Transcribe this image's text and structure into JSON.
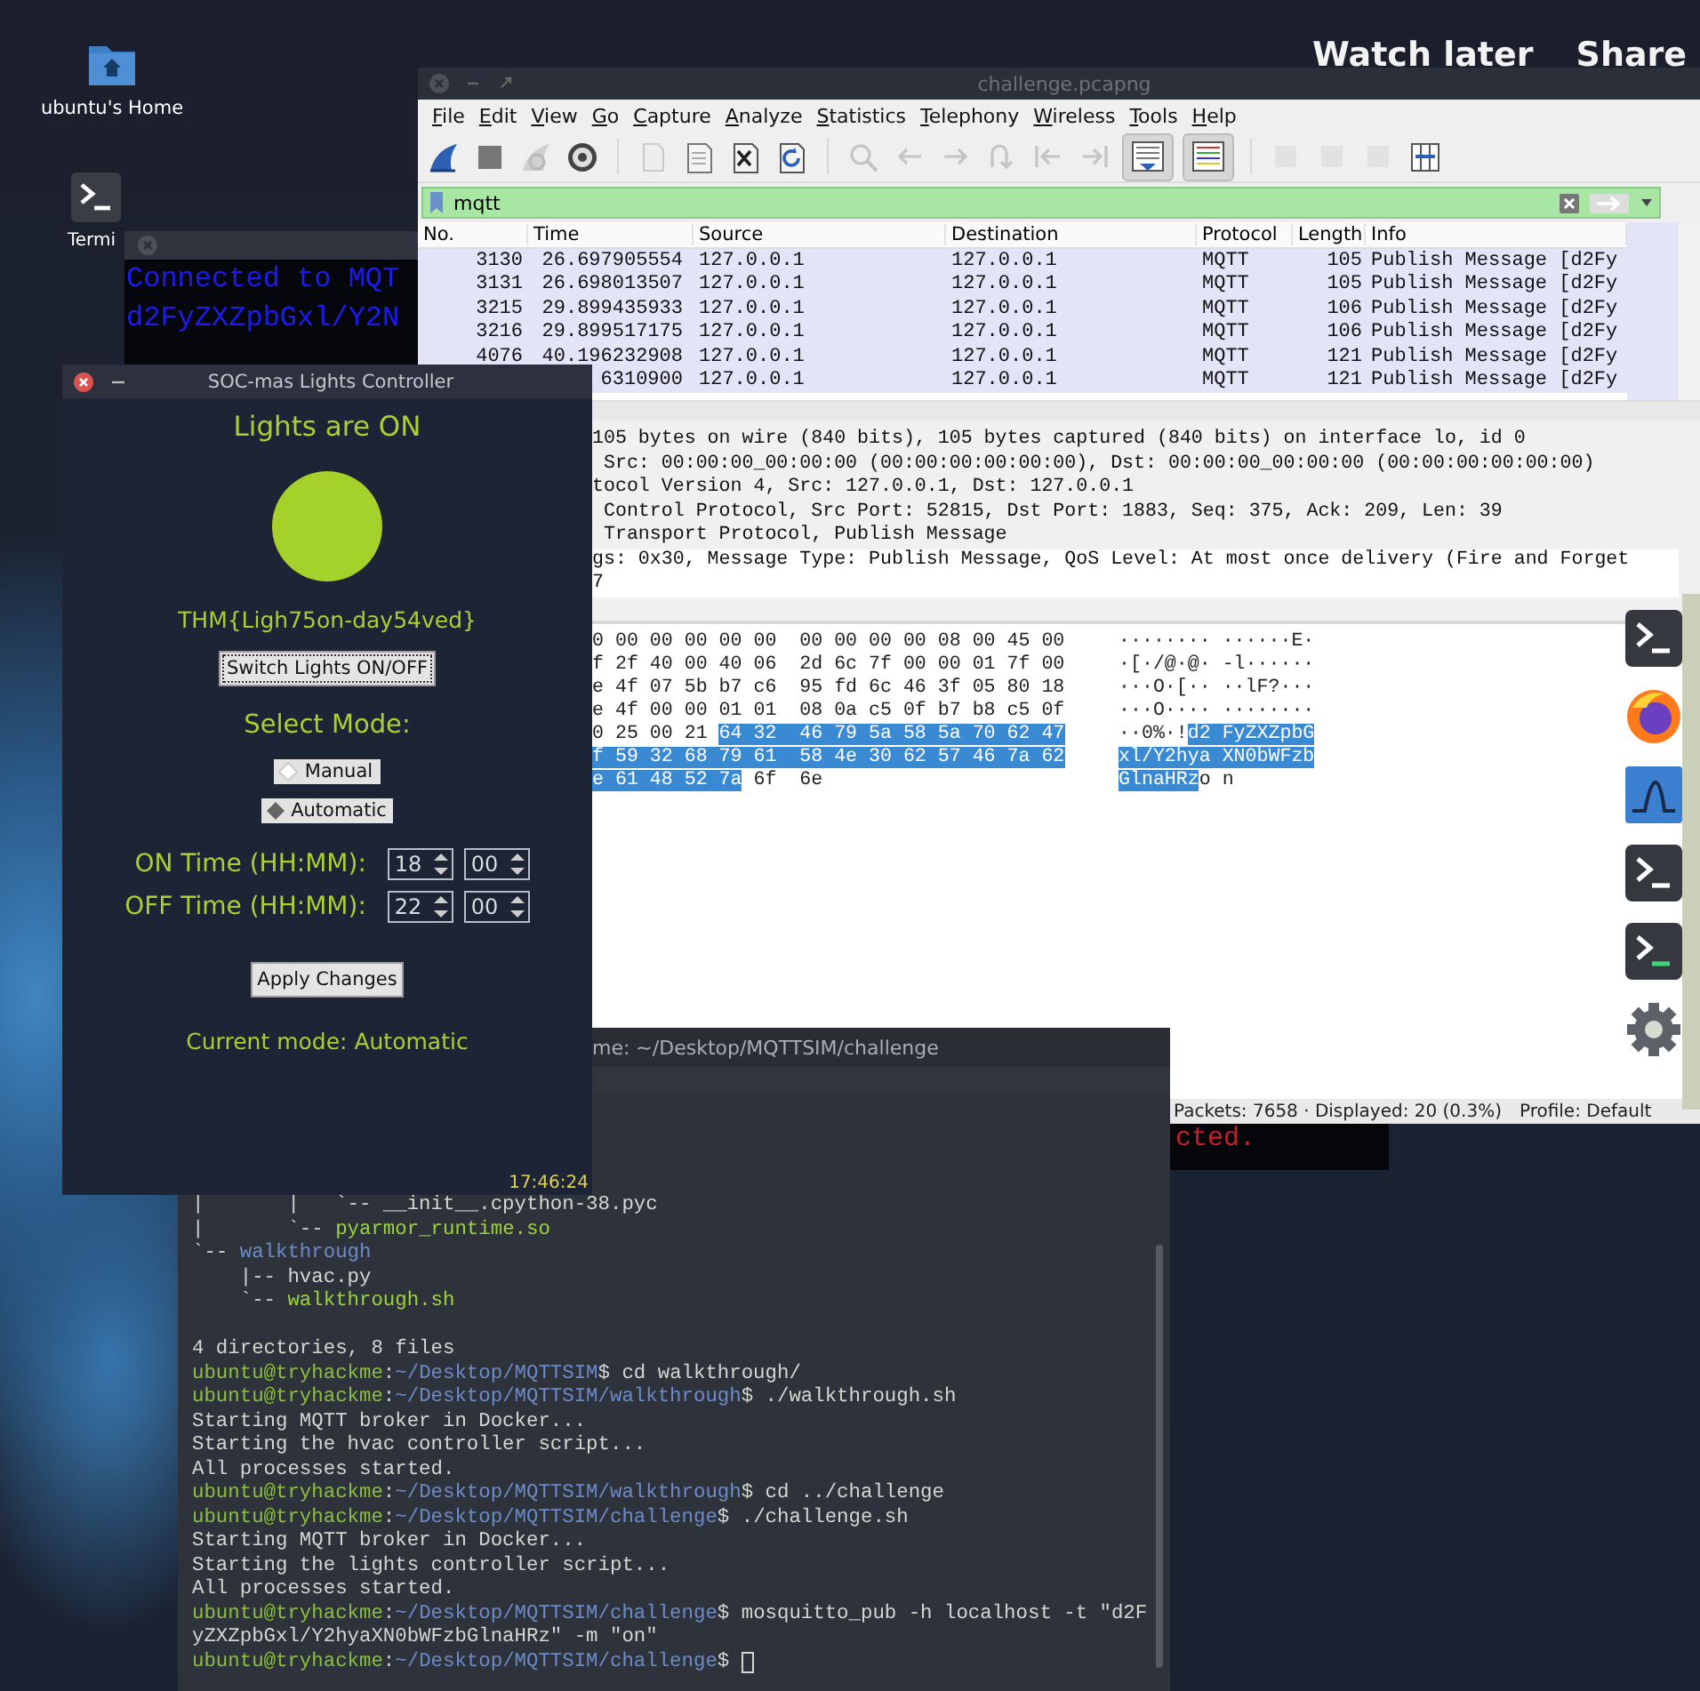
{
  "video_overlay": {
    "buttons": [
      "Watch later",
      "Share"
    ]
  },
  "desktop_icons": [
    {
      "kind": "home",
      "label": "ubuntu's Home"
    },
    {
      "kind": "terminal",
      "label": "Termi"
    }
  ],
  "background_terminal": {
    "lines": [
      "Connected to MQT",
      "d2FyZXZpbGxl/Y2N"
    ]
  },
  "wireshark": {
    "title": "challenge.pcapng",
    "menu": [
      "File",
      "Edit",
      "View",
      "Go",
      "Capture",
      "Analyze",
      "Statistics",
      "Telephony",
      "Wireless",
      "Tools",
      "Help"
    ],
    "toolbar": [
      [
        {
          "kind": "start",
          "disabled": false,
          "on": false
        },
        {
          "kind": "stop",
          "disabled": false,
          "on": false
        },
        {
          "kind": "restart",
          "disabled": true,
          "on": false
        },
        {
          "kind": "options",
          "disabled": false,
          "on": false
        }
      ],
      [
        {
          "kind": "open",
          "disabled": true,
          "on": false
        },
        {
          "kind": "save",
          "disabled": false,
          "on": false
        },
        {
          "kind": "close",
          "disabled": false,
          "on": false
        },
        {
          "kind": "reload",
          "disabled": false,
          "on": false
        }
      ],
      [
        {
          "kind": "find",
          "disabled": true,
          "on": false
        },
        {
          "kind": "back",
          "disabled": true,
          "on": false
        },
        {
          "kind": "forward",
          "disabled": true,
          "on": false
        },
        {
          "kind": "goto",
          "disabled": true,
          "on": false
        },
        {
          "kind": "first",
          "disabled": true,
          "on": false
        },
        {
          "kind": "last",
          "disabled": true,
          "on": false
        },
        {
          "kind": "autoscroll",
          "disabled": false,
          "on": true
        },
        {
          "kind": "colorize",
          "disabled": false,
          "on": true
        }
      ],
      [
        {
          "kind": "zoomin",
          "disabled": true,
          "on": false
        },
        {
          "kind": "zoomout",
          "disabled": true,
          "on": false
        },
        {
          "kind": "zoomnormal",
          "disabled": true,
          "on": false
        },
        {
          "kind": "resize",
          "disabled": false,
          "on": false
        }
      ]
    ],
    "filter": {
      "value": "mqtt"
    },
    "columns": [
      "No.",
      "Time",
      "Source",
      "Destination",
      "Protocol",
      "Length",
      "Info"
    ],
    "rows": [
      {
        "no": "3130",
        "time": "26.697905554",
        "source": "127.0.0.1",
        "destination": "127.0.0.1",
        "protocol": "MQTT",
        "length": "105",
        "info": "Publish Message [d2Fy"
      },
      {
        "no": "3131",
        "time": "26.698013507",
        "source": "127.0.0.1",
        "destination": "127.0.0.1",
        "protocol": "MQTT",
        "length": "105",
        "info": "Publish Message [d2Fy"
      },
      {
        "no": "3215",
        "time": "29.899435933",
        "source": "127.0.0.1",
        "destination": "127.0.0.1",
        "protocol": "MQTT",
        "length": "106",
        "info": "Publish Message [d2Fy"
      },
      {
        "no": "3216",
        "time": "29.899517175",
        "source": "127.0.0.1",
        "destination": "127.0.0.1",
        "protocol": "MQTT",
        "length": "106",
        "info": "Publish Message [d2Fy"
      },
      {
        "no": "4076",
        "time": "40.196232908",
        "source": "127.0.0.1",
        "destination": "127.0.0.1",
        "protocol": "MQTT",
        "length": "121",
        "info": "Publish Message [d2Fy"
      },
      {
        "time": "6310900",
        "source": "127.0.0.1",
        "destination": "127.0.0.1",
        "protocol": "MQTT",
        "length": "121",
        "info": "Publish Message [d2Fy"
      }
    ],
    "details": [
      {
        "text": "105 bytes on wire (840 bits), 105 bytes captured (840 bits) on interface lo, id 0",
        "selected": false
      },
      {
        "text": " Src: 00:00:00_00:00:00 (00:00:00:00:00:00), Dst: 00:00:00_00:00:00 (00:00:00:00:00:00)",
        "selected": false
      },
      {
        "text": "tocol Version 4, Src: 127.0.0.1, Dst: 127.0.0.1",
        "selected": false
      },
      {
        "text": " Control Protocol, Src Port: 52815, Dst Port: 1883, Seq: 375, Ack: 209, Len: 39",
        "selected": false
      },
      {
        "text": " Transport Protocol, Publish Message",
        "selected": false
      },
      {
        "text": "gs: 0x30, Message Type: Publish Message, QoS Level: At most once delivery (Fire and Forget",
        "selected": true
      },
      {
        "text": "7",
        "selected": true
      }
    ],
    "bytes": [
      {
        "hex": [
          {
            "text": "0 00 00 00 00 00  00 00 00 00 08 00 45 00",
            "selected": false
          }
        ],
        "ascii": [
          {
            "text": "········ ······E·",
            "selected": false
          }
        ]
      },
      {
        "hex": [
          {
            "text": "f 2f 40 00 40 06  2d 6c 7f 00 00 01 7f 00",
            "selected": false
          }
        ],
        "ascii": [
          {
            "text": "·[·/@·@· -l······",
            "selected": false
          }
        ]
      },
      {
        "hex": [
          {
            "text": "e 4f 07 5b b7 c6  95 fd 6c 46 3f 05 80 18",
            "selected": false
          }
        ],
        "ascii": [
          {
            "text": "···O·[·· ··lF?···",
            "selected": false
          }
        ]
      },
      {
        "hex": [
          {
            "text": "e 4f 00 00 01 01  08 0a c5 0f b7 b8 c5 0f",
            "selected": false
          }
        ],
        "ascii": [
          {
            "text": "···O···· ········",
            "selected": false
          }
        ]
      },
      {
        "hex": [
          {
            "text": "0 25 00 21 ",
            "selected": false
          },
          {
            "text": "64 32  46 79 5a 58 5a 70 62 47",
            "selected": true
          }
        ],
        "ascii": [
          {
            "text": "··0%·!",
            "selected": false
          },
          {
            "text": "d2 FyZXZpbG",
            "selected": true
          }
        ]
      },
      {
        "hex": [
          {
            "text": "f 59 32 68 79 61  58 4e 30 62 57 46 7a 62",
            "selected": true
          }
        ],
        "ascii": [
          {
            "text": "xl/Y2hya XN0bWFzb",
            "selected": true
          }
        ]
      },
      {
        "hex": [
          {
            "text": "e 61 48 52 7a",
            "selected": true
          },
          {
            "text": " 6f  6e",
            "selected": false
          }
        ],
        "ascii": [
          {
            "text": "GlnaHRz",
            "selected": true
          },
          {
            "text": "o n",
            "selected": false
          }
        ]
      }
    ],
    "status_bar": {
      "packets": "Packets: 7658 · Displayed: 20 (0.3%)",
      "profile": "Profile: Default"
    }
  },
  "background_terminal_2": {
    "text": "cted."
  },
  "terminal": {
    "title": "me: ~/Desktop/MQTTSIM/challenge",
    "cursor": true,
    "lines": [
      {
        "segments": [
          {
            "kind": "text",
            "text": "|       |   `-- __init__.cpython-38.pyc"
          }
        ]
      },
      {
        "segments": [
          {
            "kind": "text",
            "text": "|       `-- "
          },
          {
            "kind": "exec",
            "text": "pyarmor_runtime.so"
          }
        ]
      },
      {
        "segments": [
          {
            "kind": "text",
            "text": "`-- "
          },
          {
            "kind": "dir",
            "text": "walkthrough"
          }
        ]
      },
      {
        "segments": [
          {
            "kind": "text",
            "text": "    |-- hvac.py"
          }
        ]
      },
      {
        "segments": [
          {
            "kind": "text",
            "text": "    `-- "
          },
          {
            "kind": "exec",
            "text": "walkthrough.sh"
          }
        ]
      },
      {
        "kind": "blank"
      },
      {
        "segments": [
          {
            "kind": "text",
            "text": "4 directories, 8 files"
          }
        ]
      },
      {
        "segments": [
          {
            "kind": "user",
            "text": "ubuntu@tryhackme"
          },
          {
            "kind": "text",
            "text": ":"
          },
          {
            "kind": "path",
            "text": "~/Desktop/MQTTSIM"
          },
          {
            "kind": "text",
            "text": "$ cd walkthrough/"
          }
        ]
      },
      {
        "segments": [
          {
            "kind": "user",
            "text": "ubuntu@tryhackme"
          },
          {
            "kind": "text",
            "text": ":"
          },
          {
            "kind": "path",
            "text": "~/Desktop/MQTTSIM/walkthrough"
          },
          {
            "kind": "text",
            "text": "$ ./walkthrough.sh"
          }
        ]
      },
      {
        "segments": [
          {
            "kind": "text",
            "text": "Starting MQTT broker in Docker..."
          }
        ]
      },
      {
        "segments": [
          {
            "kind": "text",
            "text": "Starting the hvac controller script..."
          }
        ]
      },
      {
        "segments": [
          {
            "kind": "text",
            "text": "All processes started."
          }
        ]
      },
      {
        "segments": [
          {
            "kind": "user",
            "text": "ubuntu@tryhackme"
          },
          {
            "kind": "text",
            "text": ":"
          },
          {
            "kind": "path",
            "text": "~/Desktop/MQTTSIM/walkthrough"
          },
          {
            "kind": "text",
            "text": "$ cd ../challenge"
          }
        ]
      },
      {
        "segments": [
          {
            "kind": "user",
            "text": "ubuntu@tryhackme"
          },
          {
            "kind": "text",
            "text": ":"
          },
          {
            "kind": "path",
            "text": "~/Desktop/MQTTSIM/challenge"
          },
          {
            "kind": "text",
            "text": "$ ./challenge.sh"
          }
        ]
      },
      {
        "segments": [
          {
            "kind": "text",
            "text": "Starting MQTT broker in Docker..."
          }
        ]
      },
      {
        "segments": [
          {
            "kind": "text",
            "text": "Starting the lights controller script..."
          }
        ]
      },
      {
        "segments": [
          {
            "kind": "text",
            "text": "All processes started."
          }
        ]
      },
      {
        "segments": [
          {
            "kind": "user",
            "text": "ubuntu@tryhackme"
          },
          {
            "kind": "text",
            "text": ":"
          },
          {
            "kind": "path",
            "text": "~/Desktop/MQTTSIM/challenge"
          },
          {
            "kind": "text",
            "text": "$ mosquitto_pub -h localhost -t \"d2F"
          }
        ]
      },
      {
        "segments": [
          {
            "kind": "text",
            "text": "yZXZpbGxl/Y2hyaXN0bWFzbGlnaHRz\" -m \"on\""
          }
        ]
      },
      {
        "segments": [
          {
            "kind": "user",
            "text": "ubuntu@tryhackme"
          },
          {
            "kind": "text",
            "text": ":"
          },
          {
            "kind": "path",
            "text": "~/Desktop/MQTTSIM/challenge"
          },
          {
            "kind": "text",
            "text": "$ "
          }
        ]
      }
    ]
  },
  "lights_controller": {
    "title": "SOC-mas Lights Controller",
    "status": "Lights are ON",
    "lamp_on": true,
    "flag": "THM{Ligh75on-day54ved}",
    "toggle_button": "Switch Lights ON/OFF",
    "mode_heading": "Select Mode:",
    "modes": [
      {
        "label": "Manual",
        "selected": false
      },
      {
        "label": "Automatic",
        "selected": true
      }
    ],
    "times": [
      {
        "label": "ON Time (HH:MM):",
        "hours": "18",
        "minutes": "00"
      },
      {
        "label": "OFF Time (HH:MM):",
        "hours": "22",
        "minutes": "00"
      }
    ],
    "apply_button": "Apply Changes",
    "current_mode": "Current mode: Automatic",
    "clock": "17:46:24"
  },
  "dock": [
    {
      "kind": "terminal"
    },
    {
      "kind": "browser"
    },
    {
      "kind": "monitor"
    },
    {
      "kind": "terminal"
    },
    {
      "kind": "terminal-green"
    },
    {
      "kind": "settings"
    }
  ]
}
